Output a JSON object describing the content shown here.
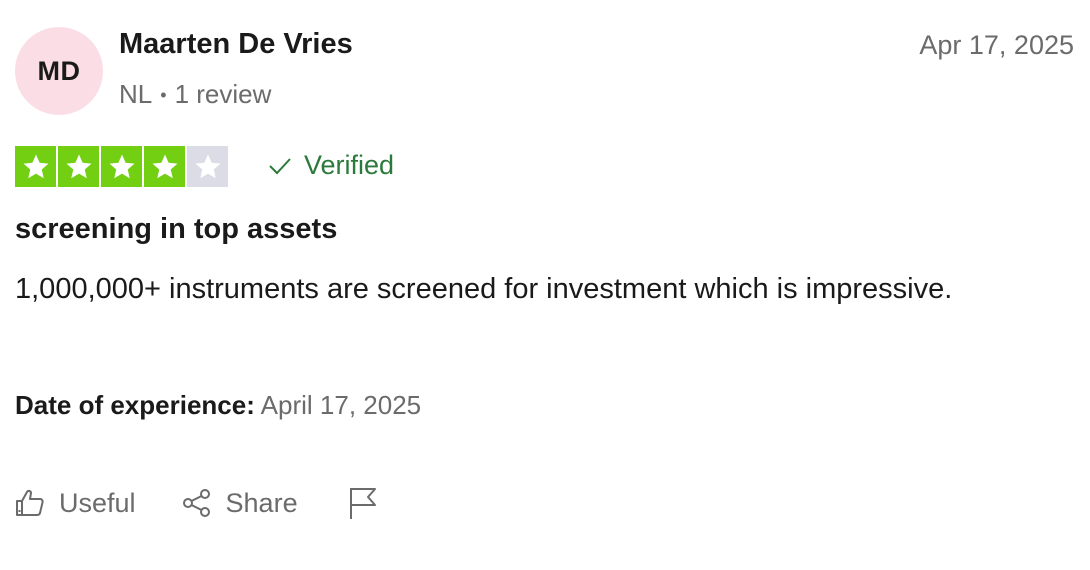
{
  "reviewer": {
    "initials": "MD",
    "name": "Maarten De Vries",
    "country": "NL",
    "separator": "•",
    "reviews": "1 review",
    "avatar_color": "#fbdde6"
  },
  "review": {
    "date": "Apr 17, 2025",
    "rating": 4,
    "max_rating": 5,
    "star_color": "#73cf11",
    "empty_star_color": "#dcdce6",
    "verified_label": "Verified",
    "verified_color": "#2b7a3b",
    "title": "screening in top assets",
    "body": "1,000,000+ instruments are screened for investment which is impressive.",
    "experience_label": "Date of experience:",
    "experience_date": "April 17, 2025"
  },
  "actions": {
    "useful_label": "Useful",
    "share_label": "Share",
    "useful_icon": "thumbs-up-icon",
    "share_icon": "share-icon",
    "report_icon": "flag-icon"
  }
}
